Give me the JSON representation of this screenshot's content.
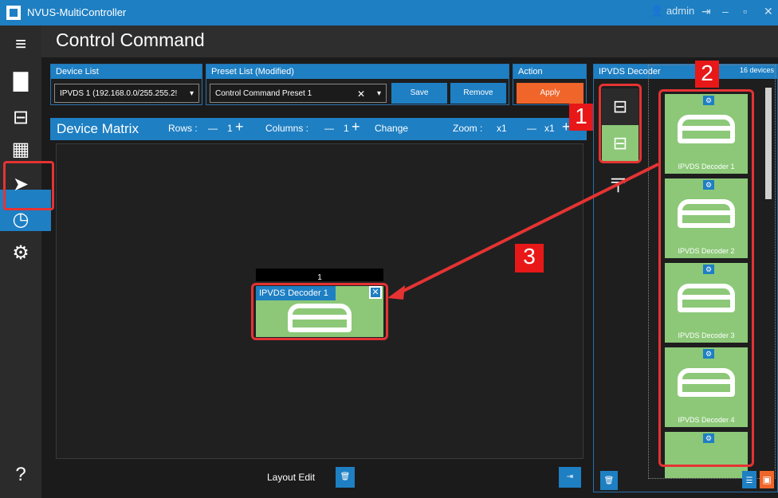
{
  "window": {
    "title": "NVUS-MultiController",
    "user": "admin"
  },
  "header": {
    "title": "Control Command"
  },
  "device_list": {
    "label": "Device List",
    "value": "IPVDS 1 (192.168.0.0/255.255.2!"
  },
  "preset_list": {
    "label": "Preset List (Modified)",
    "value": "Control Command Preset 1",
    "clear": "✕",
    "save": "Save",
    "remove": "Remove"
  },
  "action": {
    "label": "Action",
    "apply": "Apply"
  },
  "matrix": {
    "title": "Device Matrix",
    "rows_label": "Rows :",
    "rows_value": "1",
    "cols_label": "Columns :",
    "cols_value": "1",
    "change": "Change",
    "zoom_label": "Zoom :",
    "zoom_value": "x1",
    "zoom_value2": "x1",
    "minus": "—",
    "plus": "+",
    "cell_number": "1",
    "cell_title": "IPVDS Decoder 1"
  },
  "bottom": {
    "layout_edit": "Layout Edit"
  },
  "right_panel": {
    "title": "IPVDS Decoder",
    "count": "16 devices",
    "decoders": [
      "IPVDS Decoder 1",
      "IPVDS Decoder 2",
      "IPVDS Decoder 3",
      "IPVDS Decoder 4"
    ]
  },
  "annotations": {
    "one": "1",
    "two": "2",
    "three": "3"
  },
  "colors": {
    "accent": "#1e7fc3",
    "apply": "#f0652a",
    "highlight": "#e53333",
    "tile": "#8cc878"
  }
}
